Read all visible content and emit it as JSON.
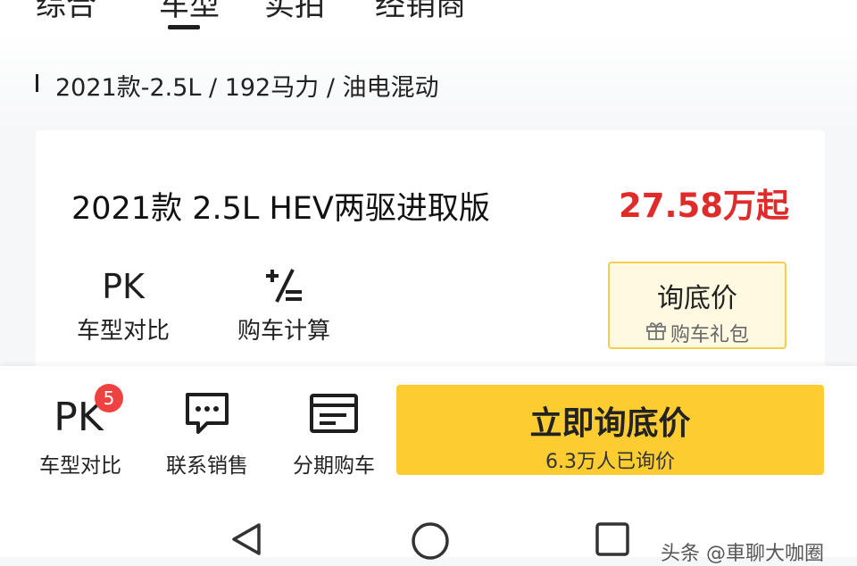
{
  "top_tabs": [
    "综合",
    "车型",
    "实拍",
    "经销商"
  ],
  "spec": {
    "text": "2021款-2.5L / 192马力 / 油电混动"
  },
  "model": {
    "name": "2021款 2.5L HEV两驱进取版",
    "price": "27.58万起"
  },
  "tools": [
    {
      "label": "车型对比",
      "icon": "pk-icon"
    },
    {
      "label": "购车计算",
      "icon": "calculator-icon"
    }
  ],
  "inquiry": {
    "title": "询底价",
    "subtitle": "购车礼包",
    "icon": "gift-icon"
  },
  "bottom": {
    "items": [
      {
        "label": "车型对比",
        "icon": "pk-icon",
        "badge": "5"
      },
      {
        "label": "联系销售",
        "icon": "chat-icon"
      },
      {
        "label": "分期购车",
        "icon": "installment-icon"
      }
    ],
    "cta_title": "立即询底价",
    "cta_sub": "6.3万人已询价"
  },
  "nav": {
    "icons": [
      "back-icon",
      "home-icon",
      "recents-icon"
    ]
  },
  "watermark": "头条 @車聊大咖圈",
  "colors": {
    "price": "#e02b2b",
    "cta": "#fccc30",
    "badge": "#f04141",
    "inquiry_border": "#f2d04d"
  }
}
